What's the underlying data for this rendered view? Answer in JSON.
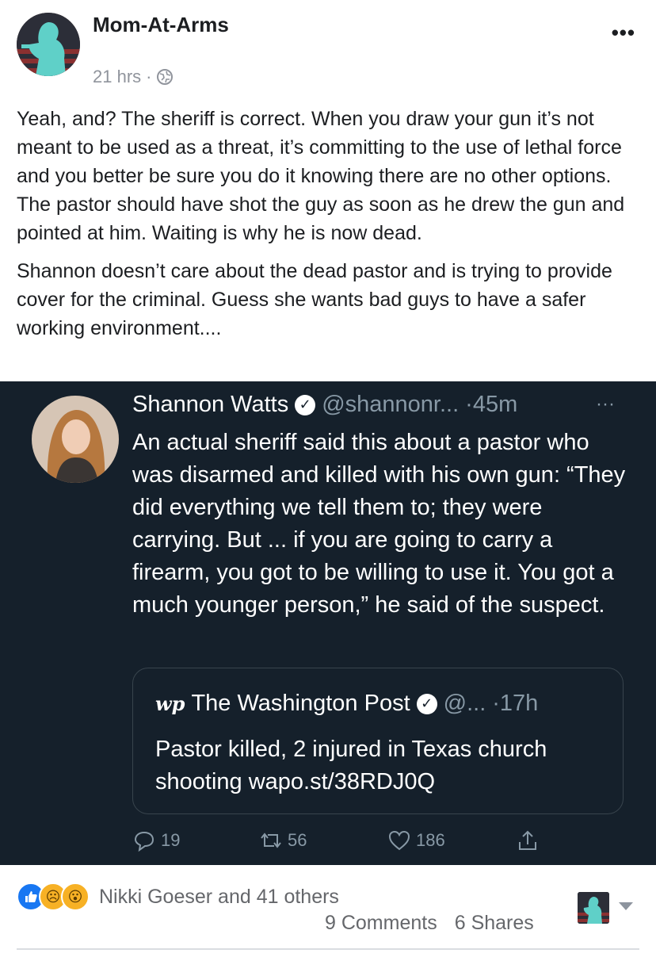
{
  "post": {
    "author": "Mom-At-Arms",
    "timestamp": "21 hrs",
    "meta_separator": "·",
    "privacy_icon": "globe-icon",
    "more_label": "•••",
    "paragraphs": [
      "Yeah, and? The sheriff is correct. When you draw your gun it’s not meant to be used as a threat, it’s committing to the use of lethal force and you better be sure you do it knowing there are no other options. The pastor should have shot the guy as soon as he drew the gun and pointed at him. Waiting is why he is now dead.",
      "Shannon doesn’t care about the dead pastor and is trying to provide cover for the criminal. Guess she wants bad guys to have a safer working environment...."
    ]
  },
  "tweet": {
    "name": "Shannon Watts",
    "handle": "@shannonr...",
    "time": "·45m",
    "more": "···",
    "text": "An actual sheriff said this about a pastor who was disarmed and killed with his own gun: “They did everything we tell them to; they were carrying. But ... if you are going to carry a firearm, you got to be willing to use it. You got a much younger person,” he said of the suspect.",
    "quote": {
      "logo": "wp",
      "name": "The Washington Post",
      "handle": "@...",
      "time": "·17h",
      "text": "Pastor killed, 2 injured in Texas church shooting wapo.st/38RDJ0Q"
    },
    "actions": {
      "replies": "19",
      "retweets": "56",
      "likes": "186"
    }
  },
  "footer": {
    "reaction_names": "Nikki Goeser and 41 others",
    "comments": "9 Comments",
    "shares": "6 Shares"
  },
  "colors": {
    "tweet_bg": "#15202b",
    "tweet_muted": "#8899a6",
    "like_blue": "#1877f2",
    "emoji_yellow": "#f7b125"
  }
}
